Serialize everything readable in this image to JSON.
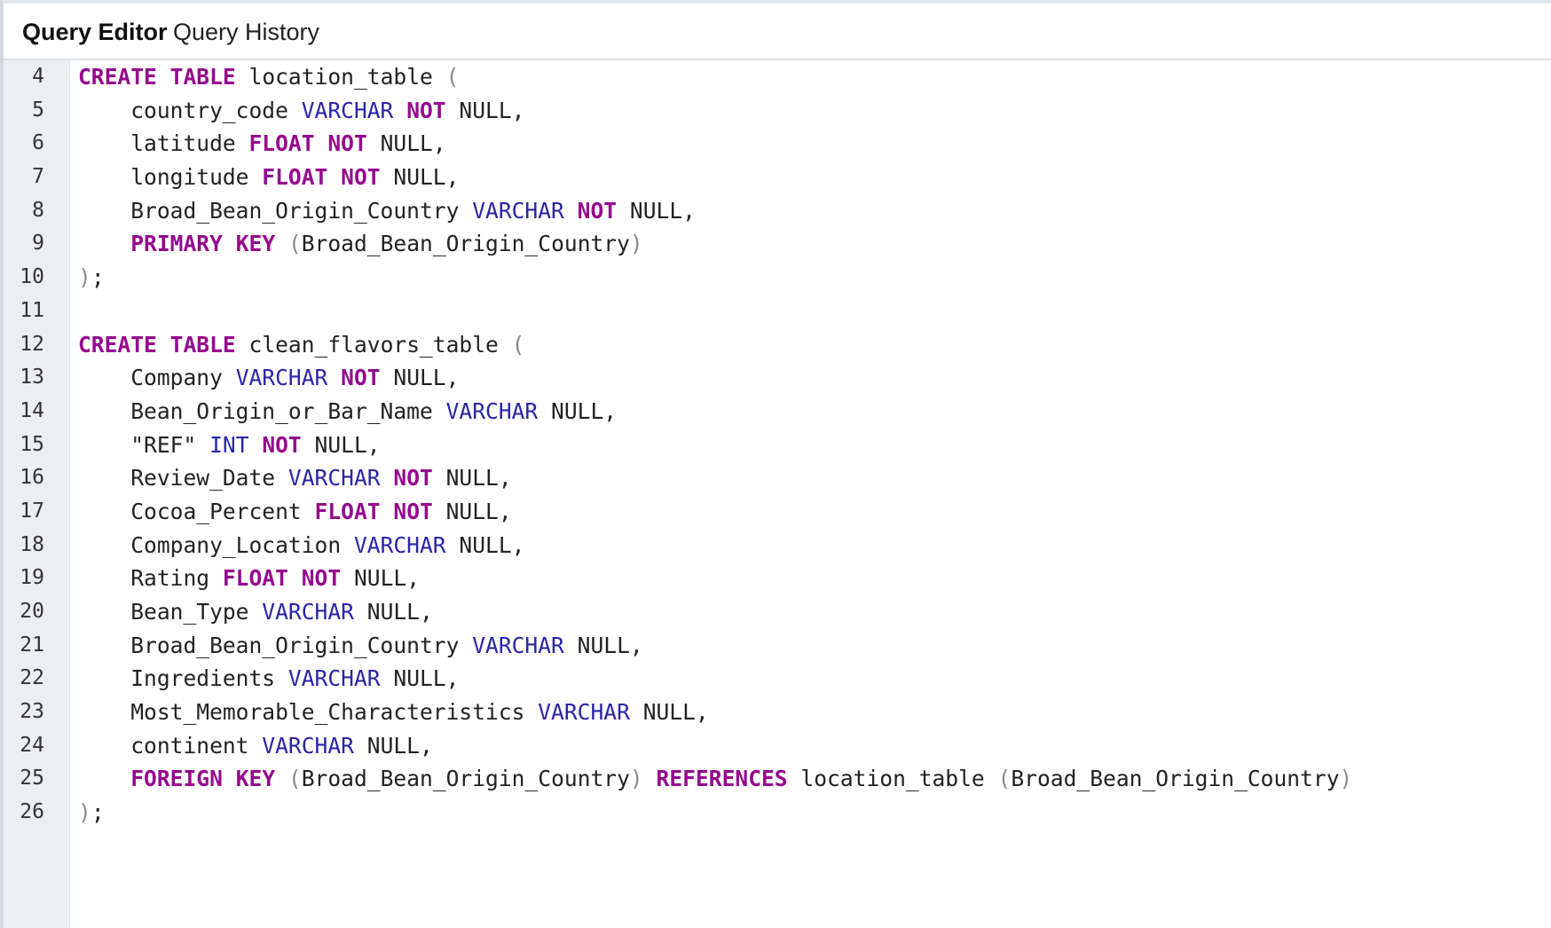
{
  "tabs": [
    {
      "label": "Query Editor",
      "active": true
    },
    {
      "label": "Query History",
      "active": false
    }
  ],
  "colors": {
    "keyword": "#950a8e",
    "type": "#2a25a6",
    "punctuation": "#8a8a8a",
    "text": "#222222",
    "gutter": "#eceef1"
  },
  "editor": {
    "lines": [
      {
        "num": "4",
        "tokens": [
          {
            "t": "CREATE",
            "c": "kw"
          },
          {
            "t": " ",
            "c": "id"
          },
          {
            "t": "TABLE",
            "c": "kw"
          },
          {
            "t": " location_table ",
            "c": "id"
          },
          {
            "t": "(",
            "c": "pn"
          }
        ]
      },
      {
        "num": "5",
        "tokens": [
          {
            "t": "    country_code ",
            "c": "id"
          },
          {
            "t": "VARCHAR",
            "c": "ty"
          },
          {
            "t": " ",
            "c": "id"
          },
          {
            "t": "NOT",
            "c": "kw"
          },
          {
            "t": " NULL,",
            "c": "id"
          }
        ]
      },
      {
        "num": "6",
        "tokens": [
          {
            "t": "    latitude ",
            "c": "id"
          },
          {
            "t": "FLOAT",
            "c": "kw"
          },
          {
            "t": " ",
            "c": "id"
          },
          {
            "t": "NOT",
            "c": "kw"
          },
          {
            "t": " NULL,",
            "c": "id"
          }
        ]
      },
      {
        "num": "7",
        "tokens": [
          {
            "t": "    longitude ",
            "c": "id"
          },
          {
            "t": "FLOAT",
            "c": "kw"
          },
          {
            "t": " ",
            "c": "id"
          },
          {
            "t": "NOT",
            "c": "kw"
          },
          {
            "t": " NULL,",
            "c": "id"
          }
        ]
      },
      {
        "num": "8",
        "tokens": [
          {
            "t": "    Broad_Bean_Origin_Country ",
            "c": "id"
          },
          {
            "t": "VARCHAR",
            "c": "ty"
          },
          {
            "t": " ",
            "c": "id"
          },
          {
            "t": "NOT",
            "c": "kw"
          },
          {
            "t": " NULL,",
            "c": "id"
          }
        ]
      },
      {
        "num": "9",
        "tokens": [
          {
            "t": "    ",
            "c": "id"
          },
          {
            "t": "PRIMARY",
            "c": "kw"
          },
          {
            "t": " ",
            "c": "id"
          },
          {
            "t": "KEY",
            "c": "kw"
          },
          {
            "t": " ",
            "c": "id"
          },
          {
            "t": "(",
            "c": "pn"
          },
          {
            "t": "Broad_Bean_Origin_Country",
            "c": "id"
          },
          {
            "t": ")",
            "c": "pn"
          }
        ]
      },
      {
        "num": "10",
        "tokens": [
          {
            "t": ")",
            "c": "pn"
          },
          {
            "t": ";",
            "c": "id"
          }
        ]
      },
      {
        "num": "11",
        "tokens": []
      },
      {
        "num": "12",
        "tokens": [
          {
            "t": "CREATE",
            "c": "kw"
          },
          {
            "t": " ",
            "c": "id"
          },
          {
            "t": "TABLE",
            "c": "kw"
          },
          {
            "t": " clean_flavors_table ",
            "c": "id"
          },
          {
            "t": "(",
            "c": "pn"
          }
        ]
      },
      {
        "num": "13",
        "tokens": [
          {
            "t": "    Company ",
            "c": "id"
          },
          {
            "t": "VARCHAR",
            "c": "ty"
          },
          {
            "t": " ",
            "c": "id"
          },
          {
            "t": "NOT",
            "c": "kw"
          },
          {
            "t": " NULL,",
            "c": "id"
          }
        ]
      },
      {
        "num": "14",
        "tokens": [
          {
            "t": "    Bean_Origin_or_Bar_Name ",
            "c": "id"
          },
          {
            "t": "VARCHAR",
            "c": "ty"
          },
          {
            "t": " NULL,",
            "c": "id"
          }
        ]
      },
      {
        "num": "15",
        "tokens": [
          {
            "t": "    \"REF\" ",
            "c": "id"
          },
          {
            "t": "INT",
            "c": "ty"
          },
          {
            "t": " ",
            "c": "id"
          },
          {
            "t": "NOT",
            "c": "kw"
          },
          {
            "t": " NULL,",
            "c": "id"
          }
        ]
      },
      {
        "num": "16",
        "tokens": [
          {
            "t": "    Review_Date ",
            "c": "id"
          },
          {
            "t": "VARCHAR",
            "c": "ty"
          },
          {
            "t": " ",
            "c": "id"
          },
          {
            "t": "NOT",
            "c": "kw"
          },
          {
            "t": " NULL,",
            "c": "id"
          }
        ]
      },
      {
        "num": "17",
        "tokens": [
          {
            "t": "    Cocoa_Percent ",
            "c": "id"
          },
          {
            "t": "FLOAT",
            "c": "kw"
          },
          {
            "t": " ",
            "c": "id"
          },
          {
            "t": "NOT",
            "c": "kw"
          },
          {
            "t": " NULL,",
            "c": "id"
          }
        ]
      },
      {
        "num": "18",
        "tokens": [
          {
            "t": "    Company_Location ",
            "c": "id"
          },
          {
            "t": "VARCHAR",
            "c": "ty"
          },
          {
            "t": " NULL,",
            "c": "id"
          }
        ]
      },
      {
        "num": "19",
        "tokens": [
          {
            "t": "    Rating ",
            "c": "id"
          },
          {
            "t": "FLOAT",
            "c": "kw"
          },
          {
            "t": " ",
            "c": "id"
          },
          {
            "t": "NOT",
            "c": "kw"
          },
          {
            "t": " NULL,",
            "c": "id"
          }
        ]
      },
      {
        "num": "20",
        "tokens": [
          {
            "t": "    Bean_Type ",
            "c": "id"
          },
          {
            "t": "VARCHAR",
            "c": "ty"
          },
          {
            "t": " NULL,",
            "c": "id"
          }
        ]
      },
      {
        "num": "21",
        "tokens": [
          {
            "t": "    Broad_Bean_Origin_Country ",
            "c": "id"
          },
          {
            "t": "VARCHAR",
            "c": "ty"
          },
          {
            "t": " NULL,",
            "c": "id"
          }
        ]
      },
      {
        "num": "22",
        "tokens": [
          {
            "t": "    Ingredients ",
            "c": "id"
          },
          {
            "t": "VARCHAR",
            "c": "ty"
          },
          {
            "t": " NULL,",
            "c": "id"
          }
        ]
      },
      {
        "num": "23",
        "tokens": [
          {
            "t": "    Most_Memorable_Characteristics ",
            "c": "id"
          },
          {
            "t": "VARCHAR",
            "c": "ty"
          },
          {
            "t": " NULL,",
            "c": "id"
          }
        ]
      },
      {
        "num": "24",
        "tokens": [
          {
            "t": "    continent ",
            "c": "id"
          },
          {
            "t": "VARCHAR",
            "c": "ty"
          },
          {
            "t": " NULL,",
            "c": "id"
          }
        ]
      },
      {
        "num": "25",
        "tokens": [
          {
            "t": "    ",
            "c": "id"
          },
          {
            "t": "FOREIGN",
            "c": "kw"
          },
          {
            "t": " ",
            "c": "id"
          },
          {
            "t": "KEY",
            "c": "kw"
          },
          {
            "t": " ",
            "c": "id"
          },
          {
            "t": "(",
            "c": "pn"
          },
          {
            "t": "Broad_Bean_Origin_Country",
            "c": "id"
          },
          {
            "t": ")",
            "c": "pn"
          },
          {
            "t": " ",
            "c": "id"
          },
          {
            "t": "REFERENCES",
            "c": "kw"
          },
          {
            "t": " location_table ",
            "c": "id"
          },
          {
            "t": "(",
            "c": "pn"
          },
          {
            "t": "Broad_Bean_Origin_Country",
            "c": "id"
          },
          {
            "t": ")",
            "c": "pn"
          }
        ]
      },
      {
        "num": "26",
        "tokens": [
          {
            "t": ")",
            "c": "pn"
          },
          {
            "t": ";",
            "c": "id"
          }
        ]
      }
    ]
  }
}
